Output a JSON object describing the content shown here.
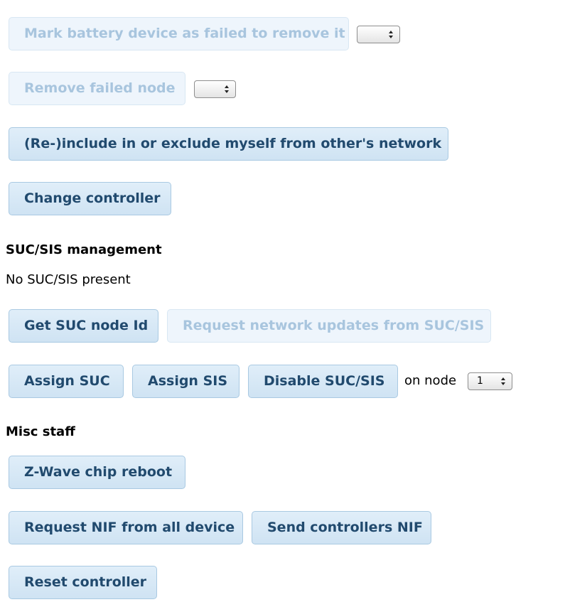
{
  "network": {
    "mark_battery_failed_label": "Mark battery device as failed to remove it",
    "mark_battery_failed_select_value": "",
    "remove_failed_node_label": "Remove failed node",
    "remove_failed_node_select_value": "",
    "include_exclude_label": "(Re-)include in or exclude myself from other's network",
    "change_controller_label": "Change controller"
  },
  "suc_sis": {
    "heading": "SUC/SIS management",
    "status": "No SUC/SIS present",
    "get_suc_node_id_label": "Get SUC node Id",
    "request_updates_label": "Request network updates from SUC/SIS",
    "assign_suc_label": "Assign SUC",
    "assign_sis_label": "Assign SIS",
    "disable_label": "Disable SUC/SIS",
    "on_node_label": "on node",
    "node_select_value": "1"
  },
  "misc": {
    "heading": "Misc staff",
    "chip_reboot_label": "Z-Wave chip reboot",
    "request_nif_label": "Request NIF from all device",
    "send_nif_label": "Send controllers NIF",
    "reset_label": "Reset controller"
  },
  "colors": {
    "button_text": "#214a6e",
    "button_bg": "#d7e8f6",
    "button_border": "#a9c9e2",
    "disabled_text": "#a8c5de",
    "disabled_bg": "#eef5fc"
  },
  "icons": {
    "select_arrows": "up-down-arrows-icon"
  }
}
